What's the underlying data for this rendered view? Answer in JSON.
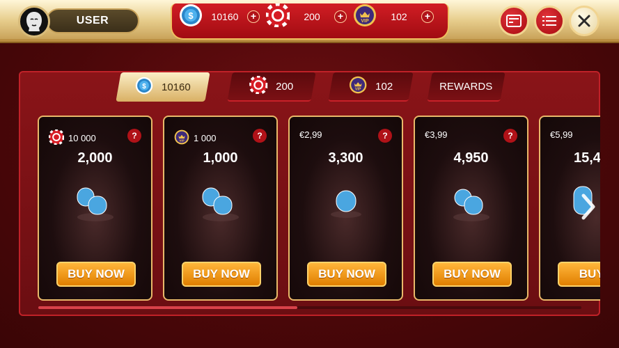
{
  "header": {
    "username": "USER",
    "currencies": [
      {
        "icon": "coin-icon",
        "value": "10160",
        "plus": "+"
      },
      {
        "icon": "chip-icon",
        "value": "200",
        "plus": "+"
      },
      {
        "icon": "vip-icon",
        "value": "102",
        "plus": "+"
      }
    ],
    "buttons": [
      "cashier-icon",
      "menu-list-icon",
      "close-icon"
    ]
  },
  "tabs": [
    {
      "label": "10160",
      "icon": "coin-icon",
      "active": true
    },
    {
      "label": "200",
      "icon": "chip-icon",
      "active": false
    },
    {
      "label": "102",
      "icon": "vip-icon",
      "active": false
    },
    {
      "label": "REWARDS",
      "active": false
    }
  ],
  "products": [
    {
      "cost": "10 000",
      "cost_icon": "chip-icon",
      "amount": "2,000",
      "help": "?",
      "buy": "BUY NOW"
    },
    {
      "cost": "1 000",
      "cost_icon": "vip-icon",
      "amount": "1,000",
      "help": "?",
      "buy": "BUY NOW"
    },
    {
      "cost": "€2,99",
      "amount": "3,300",
      "help": "?",
      "buy": "BUY NOW"
    },
    {
      "cost": "€3,99",
      "amount": "4,950",
      "help": "?",
      "buy": "BUY NOW"
    },
    {
      "cost": "€5,99",
      "amount": "15,4",
      "help": "?",
      "buy": "BUY N"
    }
  ],
  "scroll": {
    "position": 0.48
  },
  "colors": {
    "accent_red": "#b01218",
    "gold": "#e9b96a",
    "buy_orange": "#f29a12"
  }
}
